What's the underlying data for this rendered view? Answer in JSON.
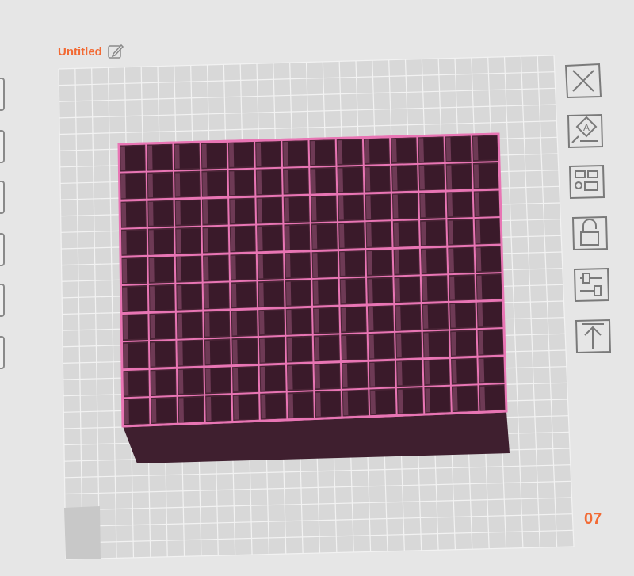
{
  "document": {
    "title": "Untitled"
  },
  "footer": {
    "page_number": "07"
  },
  "icons": {
    "edit": "pencil-icon",
    "close": "close-icon",
    "text": "text-label-icon",
    "layout": "layout-grid-icon",
    "lock": "unlock-icon",
    "adjust": "sliders-icon",
    "export": "upload-icon"
  },
  "colors": {
    "accent": "#f26a34",
    "model_fill": "#3f1f2f",
    "model_edge": "#e875b4",
    "grid_bg": "#d6d6d6",
    "grid_line": "#f2f2f2"
  },
  "model": {
    "rows": 10,
    "cols": 14
  }
}
